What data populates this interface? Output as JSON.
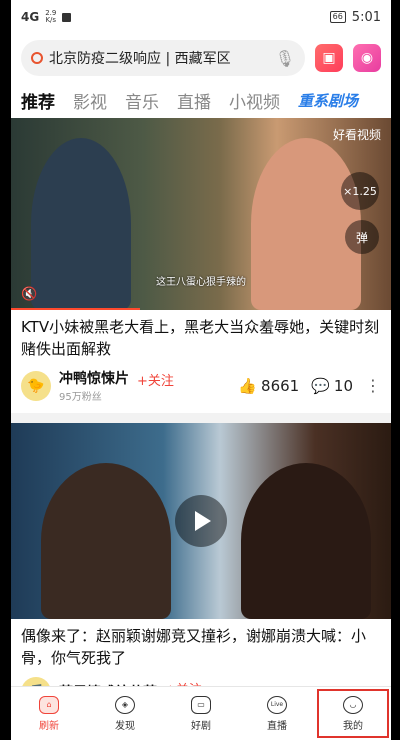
{
  "status_bar": {
    "signal": "4G",
    "speed_value": "2.9",
    "speed_unit": "K/s",
    "battery": "66",
    "time": "5:01"
  },
  "search": {
    "value": "北京防疫二级响应 | 西藏军区"
  },
  "tabs": [
    "推荐",
    "影视",
    "音乐",
    "直播",
    "小视频",
    "重系剧场"
  ],
  "feed": [
    {
      "watermark": "好看视频",
      "speed": "×1.25",
      "danmu_label": "弹",
      "subtitle": "这王八蛋心狠手辣的",
      "progress_fraction": 0.34,
      "title": "KTV小妹被黑老大看上，黑老大当众羞辱她，关键时刻赌佚出面解救",
      "author": "冲鸭惊悚片",
      "follow": "+关注",
      "fans": "95万粉丝",
      "likes": "8661",
      "comments": "10"
    },
    {
      "title": "偶像来了：赵丽颖谢娜竞又撞衫，谢娜崩溃大喊：小骨，你气死我了",
      "author": "芒果情感综艺范",
      "follow": "+关注"
    }
  ],
  "bottom_nav": [
    {
      "label": "刷新",
      "icon": "home-icon"
    },
    {
      "label": "发现",
      "icon": "compass-icon"
    },
    {
      "label": "好剧",
      "icon": "tv-icon"
    },
    {
      "label": "直播",
      "icon": "live-icon"
    },
    {
      "label": "我的",
      "icon": "smile-icon"
    }
  ],
  "colors": {
    "accent": "#f0443a",
    "special_tab": "#2a7ee8"
  }
}
